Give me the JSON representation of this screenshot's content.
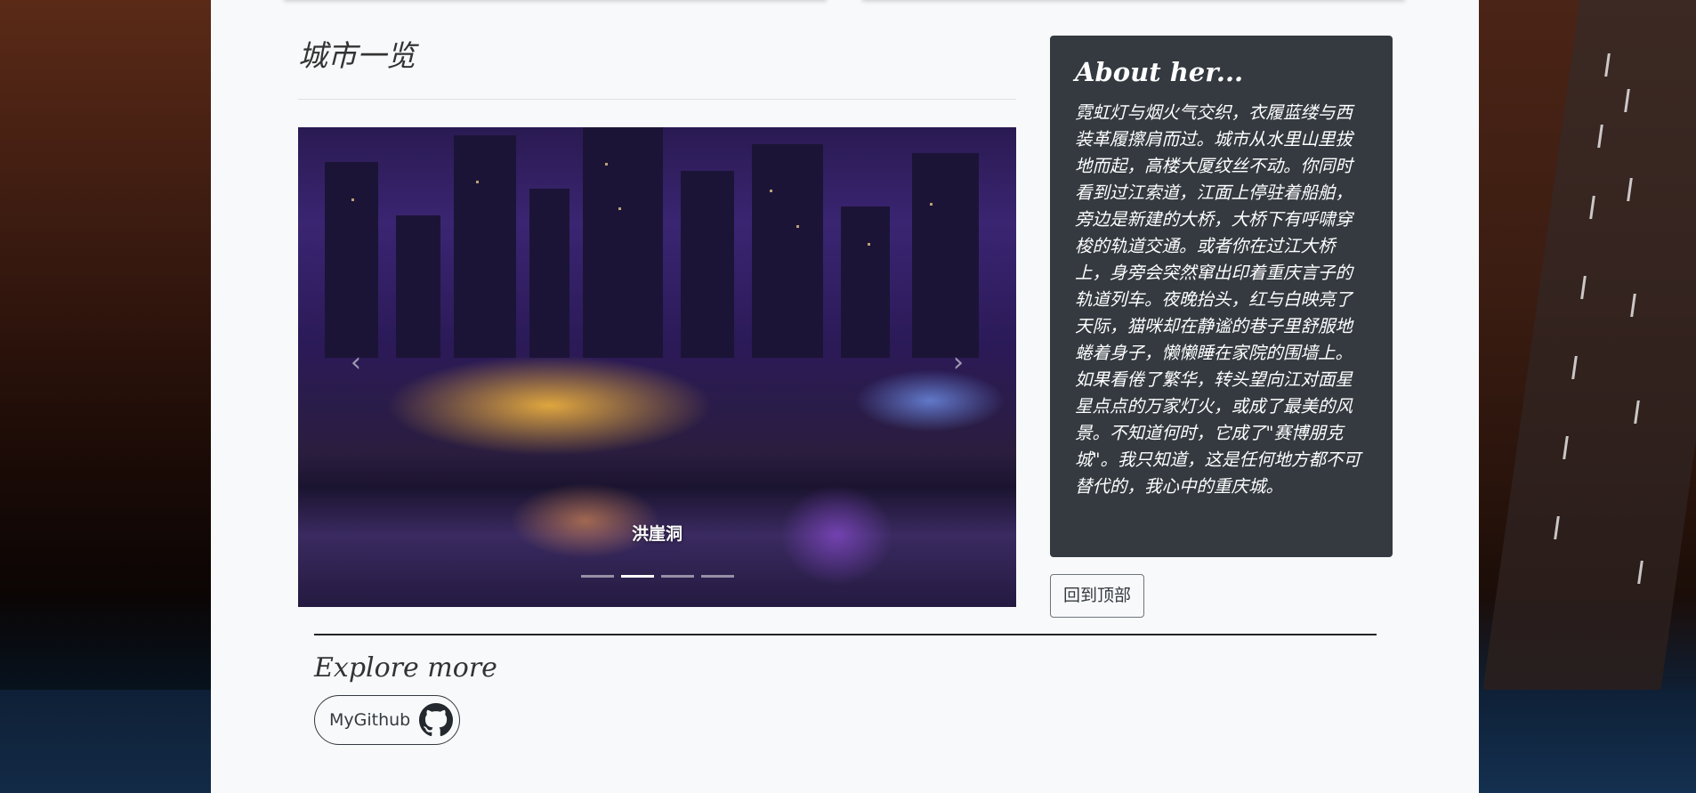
{
  "page": {
    "heading": "城市一览"
  },
  "carousel": {
    "caption": "洪崖洞",
    "indicator_count": 4,
    "active_index": 1,
    "prev_icon": "chevron-left-icon",
    "next_icon": "chevron-right-icon"
  },
  "about": {
    "title": "About her...",
    "body": "霓虹灯与烟火气交织，衣履蓝缕与西装革履擦肩而过。城市从水里山里拔地而起，高楼大厦纹丝不动。你同时看到过江索道，江面上停驻着船舶，旁边是新建的大桥，大桥下有呼啸穿梭的轨道交通。或者你在过江大桥上，身旁会突然窜出印着重庆言子的轨道列车。夜晚抬头，红与白映亮了天际，猫咪却在静谧的巷子里舒服地蜷着身子，懒懒睡在家院的围墙上。如果看倦了繁华，转头望向江对面星星点点的万家灯火，或成了最美的风景。不知道何时，它成了\"赛博朋克城\"。我只知道，这是任何地方都不可替代的，我心中的重庆城。"
  },
  "buttons": {
    "back_to_top": "回到顶部",
    "github": "MyGithub",
    "github_icon": "github-icon"
  },
  "footer": {
    "explore_title": "Explore more"
  },
  "colors": {
    "container_bg": "#f8f9fa",
    "about_bg": "#343a40",
    "text_dark": "#343a40"
  }
}
